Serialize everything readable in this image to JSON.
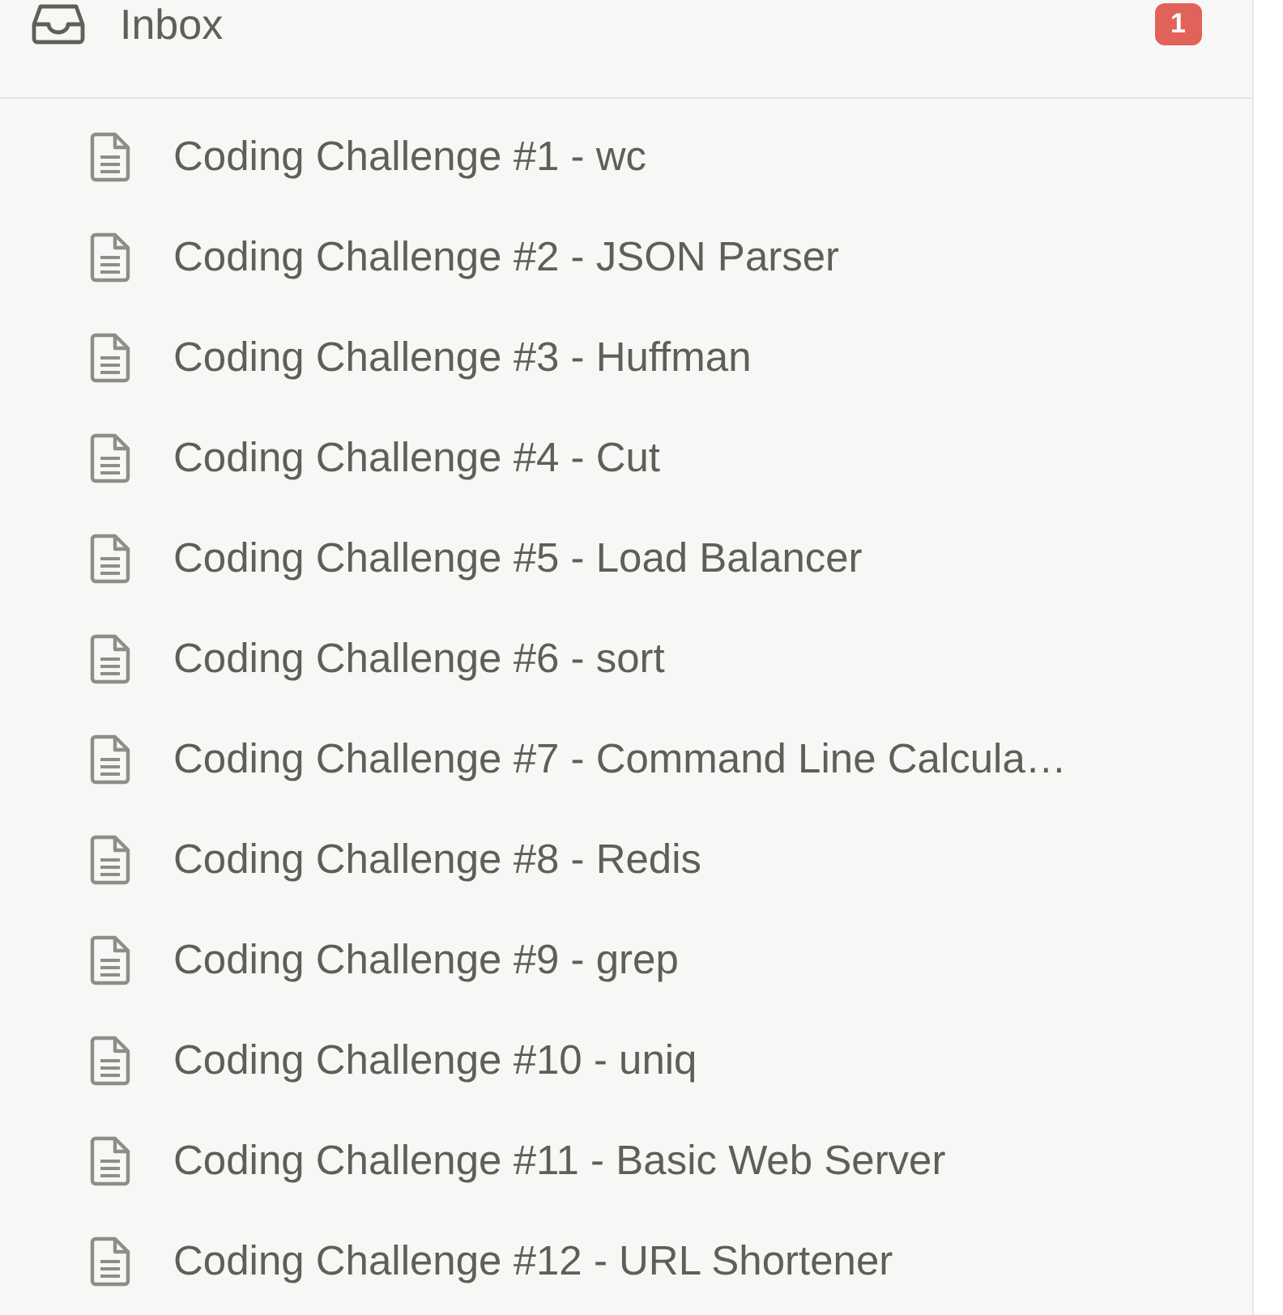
{
  "inbox": {
    "label": "Inbox",
    "badge": "1"
  },
  "pages": [
    {
      "title": "Coding Challenge #1 - wc"
    },
    {
      "title": "Coding Challenge #2 - JSON Parser"
    },
    {
      "title": "Coding Challenge #3 - Huffman"
    },
    {
      "title": "Coding Challenge #4 - Cut"
    },
    {
      "title": "Coding Challenge #5 - Load Balancer"
    },
    {
      "title": "Coding Challenge #6 - sort"
    },
    {
      "title": "Coding Challenge #7 - Command Line Calcula…"
    },
    {
      "title": "Coding Challenge #8 - Redis"
    },
    {
      "title": "Coding Challenge #9 - grep"
    },
    {
      "title": "Coding Challenge #10 - uniq"
    },
    {
      "title": "Coding Challenge #11 - Basic Web Server"
    },
    {
      "title": "Coding Challenge #12 - URL Shortener"
    }
  ]
}
